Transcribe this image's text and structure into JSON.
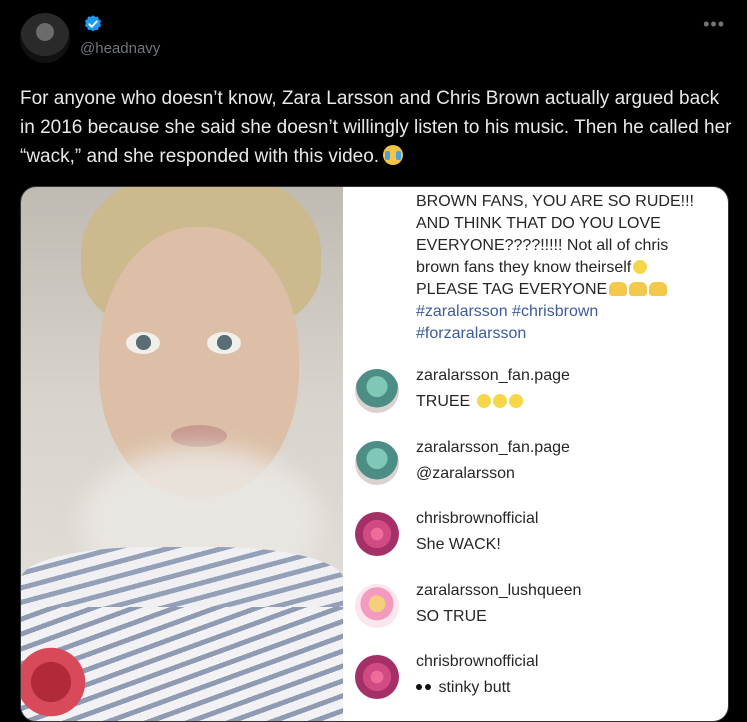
{
  "author": {
    "handle": "@headnavy",
    "avatar_icon": "avatar-image",
    "verified_icon": "verified-badge-icon",
    "verified_color": "#1d9bf0"
  },
  "more_label": "•••",
  "tweet": {
    "text": "For anyone who doesn’t know, Zara Larsson and Chris Brown actually argued back in 2016 because she said she doesn’t willingly listen to his music. Then he called her “wack,” and she responded with this video."
  },
  "media": {
    "caption": {
      "line1": "BROWN FANS, YOU ARE SO RUDE!!!",
      "line2": "AND THINK THAT DO YOU LOVE",
      "line3": "EVERYONE????!!!!! Not all of chris",
      "line4": "brown fans they know theirself",
      "line5": "PLEASE TAG EVERYONE",
      "tags1": "#zaralarsson #chrisbrown",
      "tags2": "#forzaralarsson"
    },
    "comments": [
      {
        "user": "zaralarsson_fan.page",
        "text": "TRUEE"
      },
      {
        "user": "zaralarsson_fan.page",
        "text": "@zaralarsson"
      },
      {
        "user": "chrisbrownofficial",
        "text": "She WACK!"
      },
      {
        "user": "zaralarsson_lushqueen",
        "text": "SO TRUE"
      },
      {
        "user": "chrisbrownofficial",
        "text": "stinky butt"
      }
    ]
  }
}
